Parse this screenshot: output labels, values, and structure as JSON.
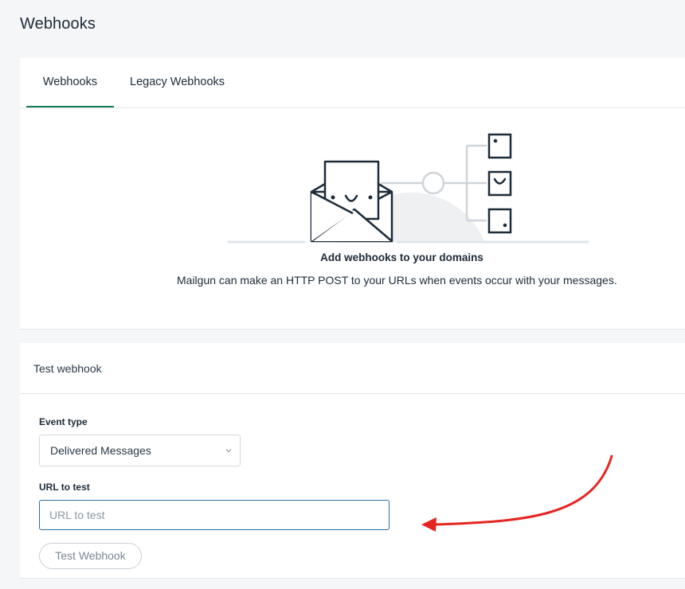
{
  "page": {
    "title": "Webhooks"
  },
  "tabs": [
    {
      "label": "Webhooks",
      "active": true
    },
    {
      "label": "Legacy Webhooks",
      "active": false
    }
  ],
  "empty_state": {
    "title": "Add webhooks to your domains",
    "description": "Mailgun can make an HTTP POST to your URLs when events occur with your messages."
  },
  "test_webhook": {
    "title": "Test webhook",
    "event_type_label": "Event type",
    "event_type_value": "Delivered Messages",
    "url_label": "URL to test",
    "url_placeholder": "URL to test",
    "url_value": "",
    "button_label": "Test Webhook"
  },
  "colors": {
    "accent": "#177a5a",
    "annotation_arrow": "#e52521",
    "input_focus_border": "#2a6fa8"
  },
  "icons": [
    "envelope-smile-icon",
    "checkbox-list-icon",
    "chevron-down-icon",
    "annotation-arrow"
  ]
}
